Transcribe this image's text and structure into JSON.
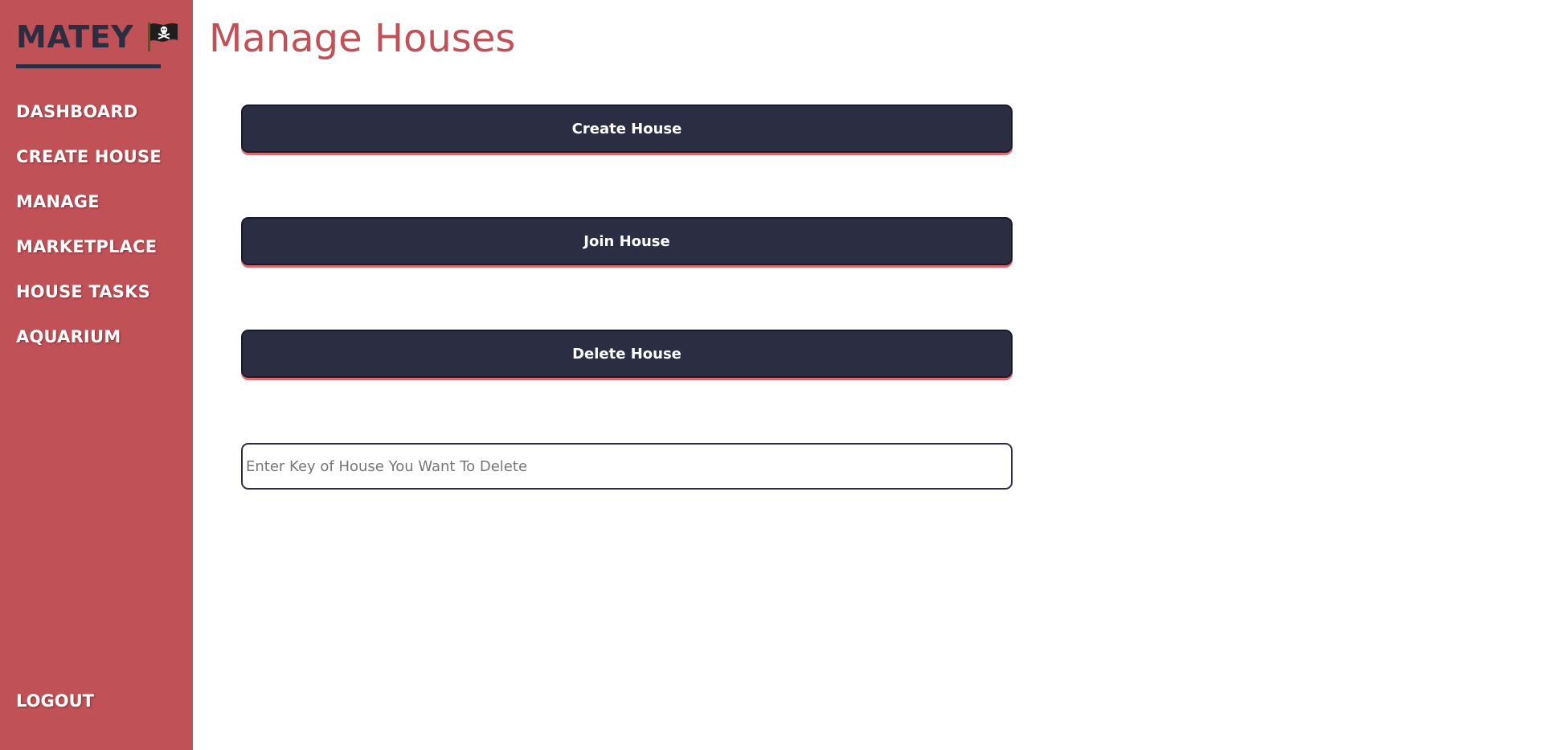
{
  "brand": {
    "name": "MATEY",
    "icon": "pirate-flag-icon"
  },
  "sidebar": {
    "items": [
      {
        "label": "DASHBOARD"
      },
      {
        "label": "CREATE HOUSE"
      },
      {
        "label": "MANAGE"
      },
      {
        "label": "MARKETPLACE"
      },
      {
        "label": "HOUSE TASKS"
      },
      {
        "label": "AQUARIUM"
      }
    ],
    "logout_label": "LOGOUT"
  },
  "main": {
    "title": "Manage Houses",
    "create_label": "Create House",
    "join_label": "Join House",
    "delete_label": "Delete House",
    "delete_key_placeholder": "Enter Key of House You Want To Delete",
    "delete_key_value": ""
  },
  "colors": {
    "sidebar_bg": "#c05156",
    "dark": "#2b2d42",
    "accent": "#c05156",
    "button_shadow": "#e06a70"
  }
}
